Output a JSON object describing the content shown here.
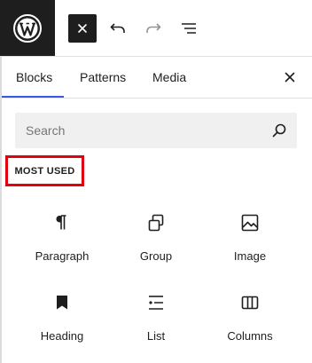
{
  "topbar": {
    "logo_icon": "wordpress-logo-icon",
    "close_icon": "close-icon",
    "undo_icon": "undo-icon",
    "redo_icon": "redo-icon",
    "document_overview_icon": "list-view-icon"
  },
  "tabs": [
    {
      "label": "Blocks",
      "active": true
    },
    {
      "label": "Patterns",
      "active": false
    },
    {
      "label": "Media",
      "active": false
    }
  ],
  "search": {
    "placeholder": "Search",
    "value": ""
  },
  "section": {
    "title": "MOST USED"
  },
  "blocks": [
    {
      "label": "Paragraph",
      "icon": "paragraph-icon"
    },
    {
      "label": "Group",
      "icon": "group-icon"
    },
    {
      "label": "Image",
      "icon": "image-icon"
    },
    {
      "label": "Heading",
      "icon": "heading-bookmark-icon"
    },
    {
      "label": "List",
      "icon": "list-icon"
    },
    {
      "label": "Columns",
      "icon": "columns-icon"
    }
  ],
  "colors": {
    "accent": "#3858e9",
    "highlight_box": "#e1000f",
    "dark": "#1e1e1e"
  }
}
